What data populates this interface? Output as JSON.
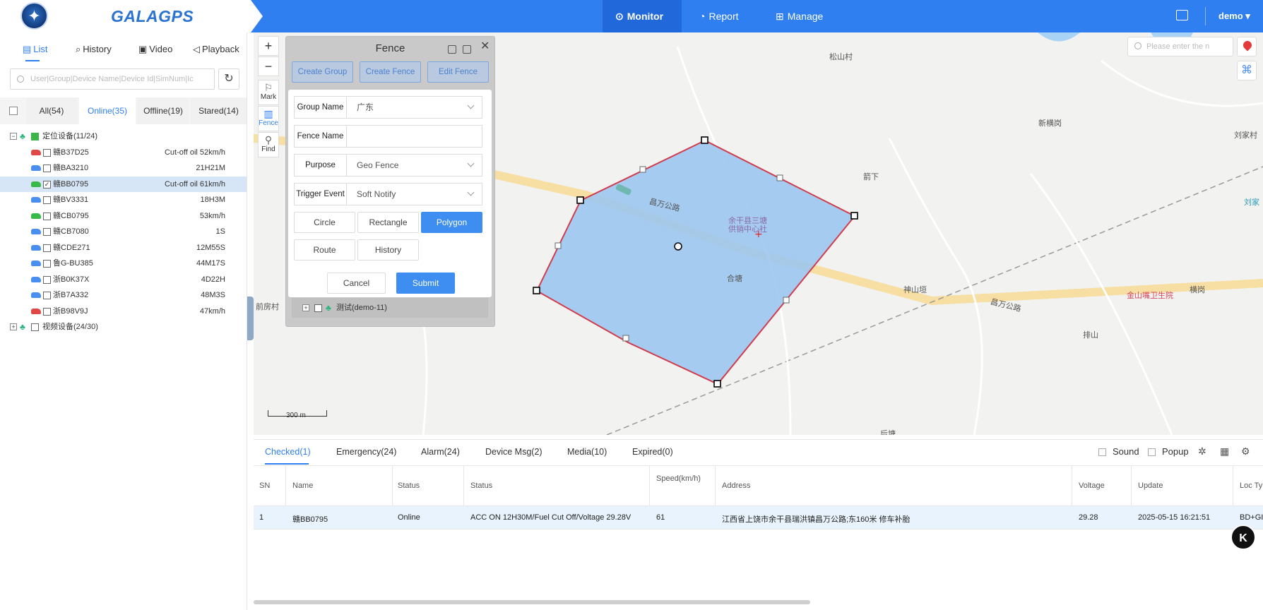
{
  "header": {
    "logo_text": "GALAGPS",
    "nav": [
      {
        "label": "Monitor",
        "icon": "location-pin-icon"
      },
      {
        "label": "Report",
        "icon": "chart-icon"
      },
      {
        "label": "Manage",
        "icon": "grid-icon"
      }
    ],
    "user": "demo",
    "logo_icon": "compass-star-icon",
    "accent": "#2f7ff0"
  },
  "sidebar": {
    "tabs": [
      {
        "label": "List"
      },
      {
        "label": "History"
      },
      {
        "label": "Video"
      },
      {
        "label": "Playback"
      }
    ],
    "search_placeholder": "User|Group|Device Name|Device Id|SimNum|Ic",
    "filters": [
      {
        "label": "All(54)"
      },
      {
        "label": "Online(35)"
      },
      {
        "label": "Offline(19)"
      },
      {
        "label": "Stared(14)"
      }
    ],
    "groups": [
      {
        "label": "定位设备(11/24)",
        "expand": "−"
      },
      {
        "label": "视频设备(24/30)",
        "expand": "+"
      }
    ],
    "devices": [
      {
        "name": "赣B37D25",
        "status": "Cut-off oil 52km/h",
        "color": "red"
      },
      {
        "name": "赣BA3210",
        "status": "21H21M",
        "color": "blue"
      },
      {
        "name": "赣BB0795",
        "status": "Cut-off oil 61km/h",
        "color": "green"
      },
      {
        "name": "赣BV3331",
        "status": "18H3M",
        "color": "blue"
      },
      {
        "name": "赣CB0795",
        "status": "53km/h",
        "color": "green"
      },
      {
        "name": "赣CB7080",
        "status": "1S",
        "color": "blue"
      },
      {
        "name": "赣CDE271",
        "status": "12M55S",
        "color": "blue"
      },
      {
        "name": "鲁G-BU385",
        "status": "44M17S",
        "color": "blue"
      },
      {
        "name": "浙B0K37X",
        "status": "4D22H",
        "color": "blue"
      },
      {
        "name": "浙B7A332",
        "status": "48M3S",
        "color": "blue"
      },
      {
        "name": "浙B98V9J",
        "status": "47km/h",
        "color": "red"
      }
    ]
  },
  "map": {
    "tools": [
      {
        "label": "Mark"
      },
      {
        "label": "Fence"
      },
      {
        "label": "Find"
      }
    ],
    "search_placeholder": "Please enter the n",
    "scale": "300 m",
    "labels": [
      "松山村",
      "新横岗",
      "刘家村",
      "箭下",
      "昌万公路",
      "余干县三塘",
      "供销中心社",
      "合塘",
      "神山垣",
      "昌万公路",
      "金山嘴卫生院",
      "横岗",
      "排山",
      "前房村",
      "后塘",
      "刘家"
    ]
  },
  "fence": {
    "title": "Fence",
    "actions": [
      "Create Group",
      "Create Fence",
      "Edit Fence"
    ],
    "group_name_label": "Group Name",
    "group_name_value": "广东",
    "fence_name_label": "Fence Name",
    "fence_name_value": "",
    "purpose_label": "Purpose",
    "purpose_value": "Geo Fence",
    "trigger_label": "Trigger Event",
    "trigger_value": "Soft Notify",
    "shapes": [
      "Circle",
      "Rectangle",
      "Polygon",
      "Route",
      "History"
    ],
    "cancel": "Cancel",
    "submit": "Submit",
    "group_row": "测试(demo-11)"
  },
  "bottom": {
    "tabs": [
      {
        "label": "Checked(1)"
      },
      {
        "label": "Emergency(24)"
      },
      {
        "label": "Alarm(24)"
      },
      {
        "label": "Device Msg(2)"
      },
      {
        "label": "Media(10)"
      },
      {
        "label": "Expired(0)"
      }
    ],
    "options": {
      "sound": "Sound",
      "popup": "Popup"
    },
    "columns": [
      "SN",
      "Name",
      "Status",
      "Status",
      "Speed(km/h)",
      "Address",
      "Voltage",
      "Update",
      "Loc Ty"
    ],
    "rows": [
      {
        "sn": "1",
        "name": "赣BB0795",
        "status": "Online",
        "detail": "ACC ON 12H30M/Fuel Cut Off/Voltage 29.28V",
        "speed": "61",
        "address": "江西省上饶市余干县瑞洪镇昌万公路;东160米 修车补胎",
        "voltage": "29.28",
        "update": "2025-05-15 16:21:51",
        "loc": "BD+GI"
      }
    ]
  },
  "fab_label": "K"
}
